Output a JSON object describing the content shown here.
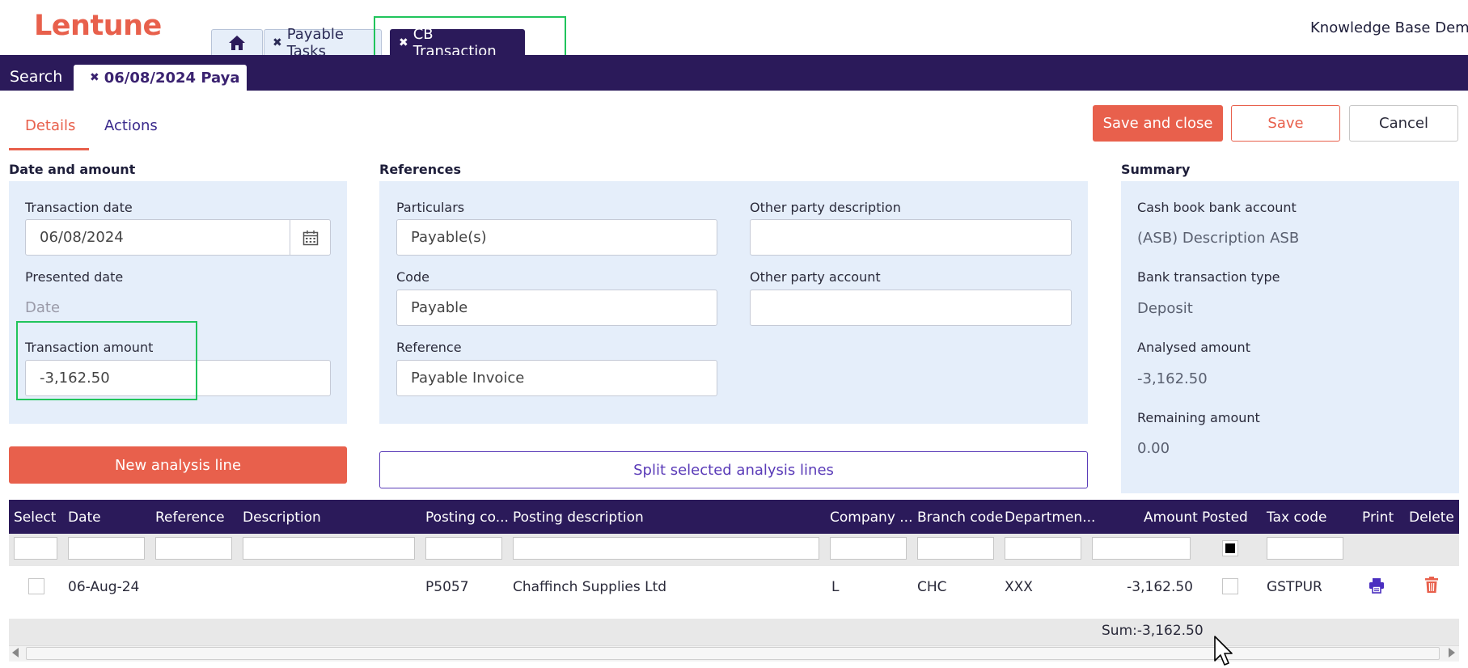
{
  "brand": {
    "logo_text": "Lentune"
  },
  "top_tabs": {
    "payable_tasks": "Payable Tasks",
    "cb_transaction": "CB Transaction"
  },
  "header": {
    "company": "Knowledge Base Demo"
  },
  "band": {
    "search_label": "Search",
    "open_tab": "06/08/2024 Paya"
  },
  "detail_tabs": {
    "details": "Details",
    "actions": "Actions"
  },
  "buttons": {
    "save_and_close": "Save and close",
    "save": "Save",
    "cancel": "Cancel",
    "new_analysis_line": "New analysis line",
    "split_selected": "Split selected analysis lines"
  },
  "date_amount": {
    "heading": "Date and amount",
    "transaction_date_label": "Transaction date",
    "transaction_date_value": "06/08/2024",
    "presented_date_label": "Presented date",
    "presented_date_placeholder": "Date",
    "transaction_amount_label": "Transaction amount",
    "transaction_amount_value": "-3,162.50"
  },
  "references": {
    "heading": "References",
    "particulars_label": "Particulars",
    "particulars_value": "Payable(s)",
    "other_party_desc_label": "Other party description",
    "other_party_desc_value": "",
    "code_label": "Code",
    "code_value": "Payable",
    "other_party_account_label": "Other party account",
    "other_party_account_value": "",
    "reference_label": "Reference",
    "reference_value": "Payable Invoice"
  },
  "summary": {
    "heading": "Summary",
    "bank_account_label": "Cash book bank account",
    "bank_account_value": "(ASB) Description ASB",
    "transaction_type_label": "Bank transaction type",
    "transaction_type_value": "Deposit",
    "analysed_label": "Analysed amount",
    "analysed_value": "-3,162.50",
    "remaining_label": "Remaining amount",
    "remaining_value": "0.00"
  },
  "grid": {
    "columns": {
      "select": "Select",
      "date": "Date",
      "reference": "Reference",
      "description": "Description",
      "posting_code": "Posting co...",
      "posting_description": "Posting description",
      "company": "Company ...",
      "branch_code": "Branch code",
      "department": "Departmen...",
      "amount": "Amount",
      "posted": "Posted",
      "tax_code": "Tax code",
      "print": "Print",
      "delete": "Delete"
    },
    "rows": [
      {
        "date": "06-Aug-24",
        "reference": "",
        "description": "",
        "posting_code": "P5057",
        "posting_description": "Chaffinch Supplies Ltd",
        "company": "L",
        "branch_code": "CHC",
        "department": "XXX",
        "amount": "-3,162.50",
        "tax_code": "GSTPUR"
      }
    ],
    "sum_text": "Sum:-3,162.50"
  },
  "icons": {
    "home": "home-icon",
    "close": "close-icon",
    "calendar": "calendar-icon",
    "print": "printer-icon",
    "delete": "trash-icon"
  },
  "colors": {
    "brand": "#e8604c",
    "navy": "#2b1a5a",
    "panel": "#e5eefa",
    "highlight": "#21c45c"
  }
}
